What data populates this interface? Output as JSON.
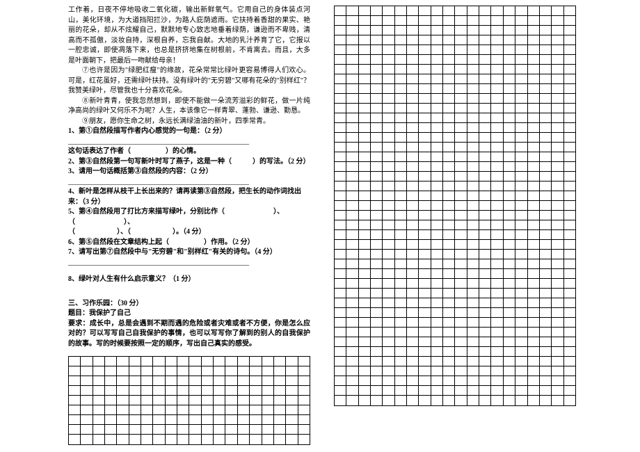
{
  "reading": {
    "para1": "工作着，日夜不停地吸收二氧化碳，输出新鲜氧气。它用自己的身体装点河山，美化环境，为大道挡阳拦沙，为路人庇荫遮雨。它扶持着香甜的果实、艳丽的花朵，却从不炫耀自己，默默地专心致志地垂着绿荫，谦逊而不卑贱，清高而不孤傲，淡妆自持，深根自养，忘我自献。大地的乳汁养育了它，它报以一腔忠诚，即使凋落下来，也总是挤挤地集在树根前，不肯离去。而且，大多是叶面朝下，把最后一吻献给母亲！",
    "para2": "⑦也许是因为\"绿肥红瘦\"的缘故，花朵常常比绿叶更容易博得人们欢心。可是，红花虽好，还需绿叶扶持。没有绿叶的\"无穷碧\"又哪有花朵的\"别样红\"？我赞美绿叶，尽管我也十分喜欢花朵。",
    "para3": "⑧新叶青青，使我忽然想到，即使不能做一朵流芳溢彩的鲜花，做一片纯净高尚的绿叶又何乐不为呢？人生，本该像它一样青翠、蓬勃、谦逊、勤恳。",
    "para4": "⑨朋友，愿你生命之树，永远长满绿油油的新叶，四季常青。"
  },
  "questions": {
    "q1a": "1、第①自然段描写作者内心感觉的一句是：（2 分）",
    "q1b_blank": "____________________________________________________",
    "q1b": "这句话表达了作者（　　　　　）的心情。",
    "q2": "2、第③自然段第一句写新叶时写了燕子，这是一种（　　　）的写法。（2 分）",
    "q3": "3、请用一句话概括第③自然段的内容：（2 分）",
    "q3_blank": "____________________________________________________",
    "q4": "4、新叶是怎样从枝干上长出来的？请再读第③自然段，把生长的动作词找出来：（3 分）",
    "q5a": "5、第④自然段用了打比方来描写绿叶，分别比作（　　　　　　　）、（　　　　　　　）、",
    "q5b": "（　　　　　　）、（　　　　　　）。（4 分）",
    "q6": "6、第⑤自然段在文章结构上起（　　　　　）作用。（2 分）",
    "q7": "7、请写出第⑦自然段中与\"无穷碧\"和\"别样红\"有关的诗句。（4 分）",
    "q7_blank": "____________________________________________________",
    "q8": "8、绿叶对人生有什么启示意义？（1 分）"
  },
  "composition": {
    "heading": "三、习作乐园：（30 分）",
    "title": "题目：我保护了自己",
    "req": "要求：成长中，总是会遇到不期而遇的危险或者灾难或者不方便，你是怎么应对的？可以写写自己自我保护的事情，也可以写写你了解到的别人的自我保护的故事。写的时候要按照一定的顺序，写出自己真实的感受。"
  },
  "grids": {
    "left_rows": 9,
    "left_cols": 20,
    "right_rows": 41,
    "right_cols": 20
  }
}
